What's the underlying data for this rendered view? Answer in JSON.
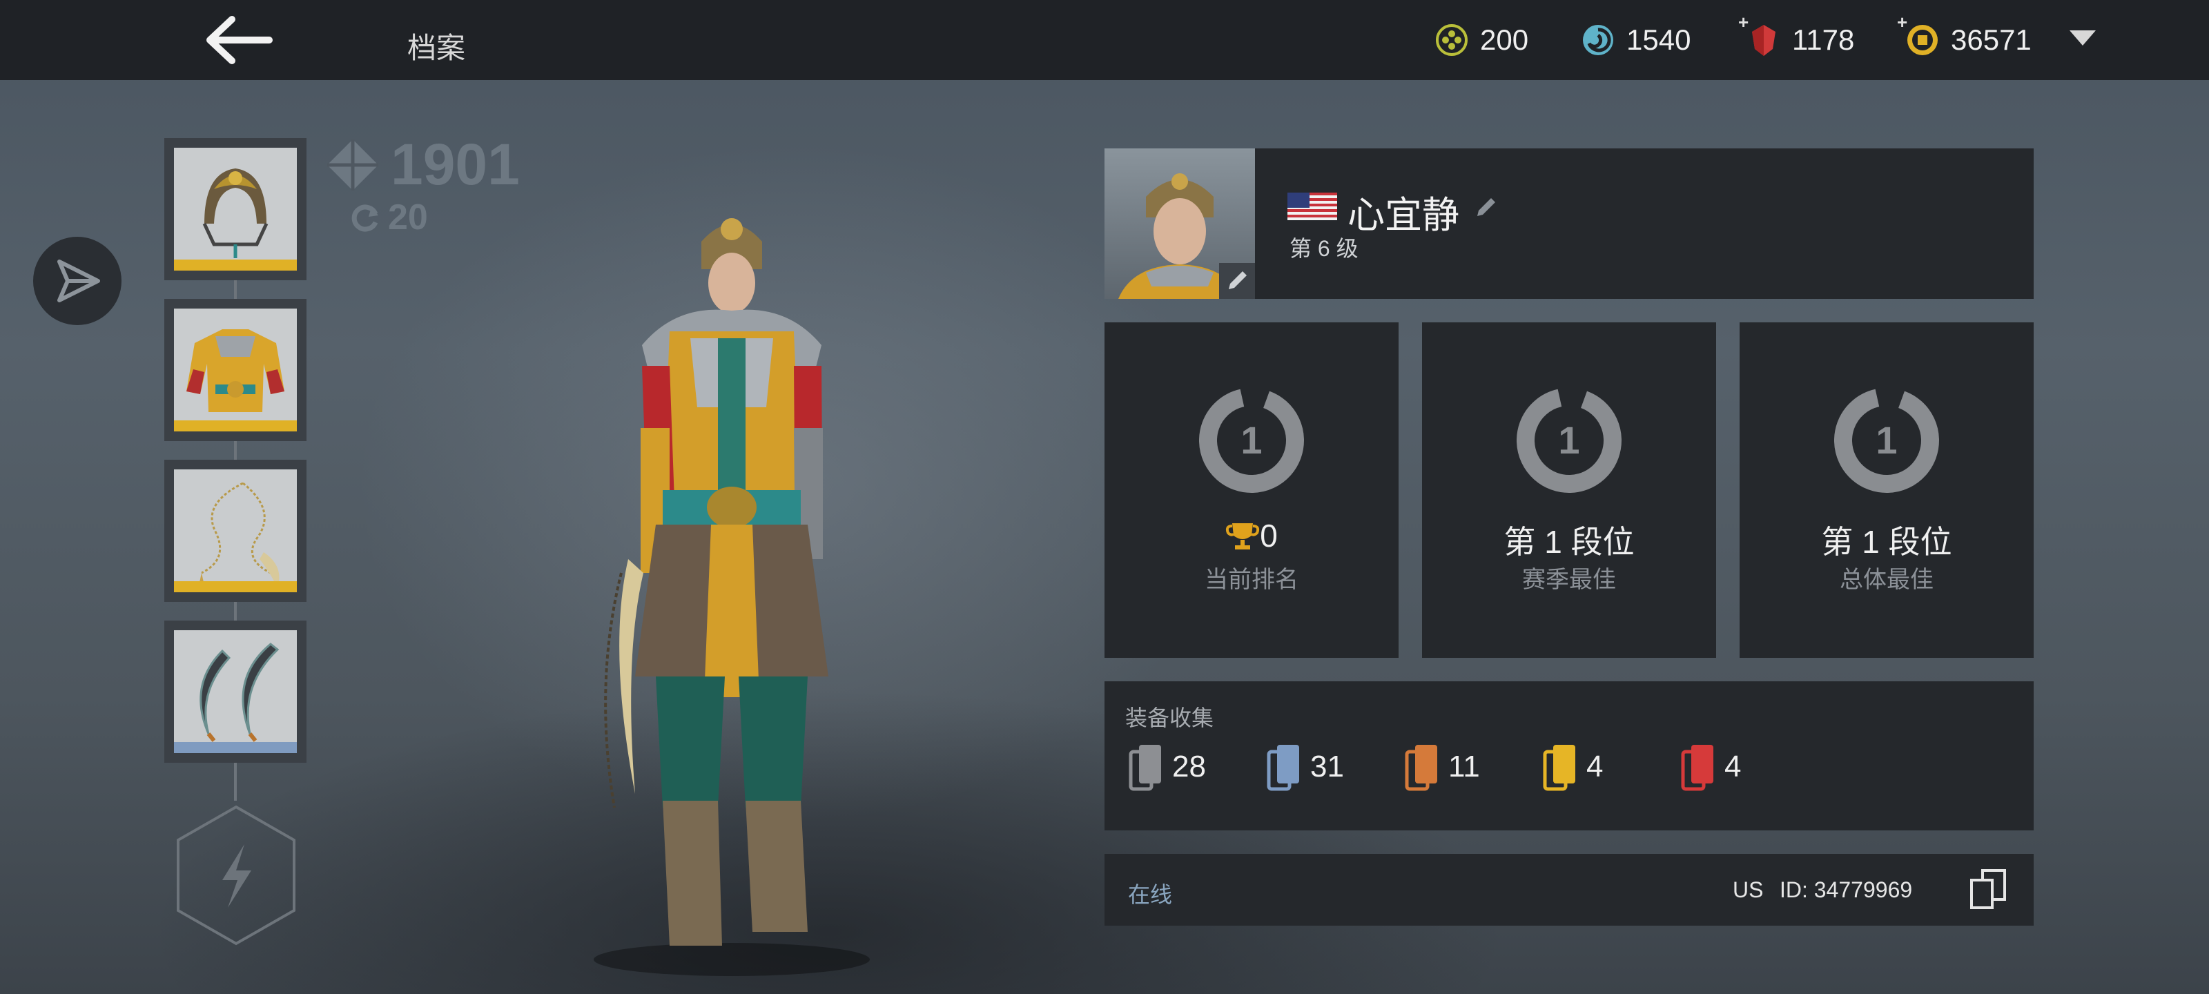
{
  "header": {
    "title": "档案",
    "currencies": [
      {
        "name": "tokens",
        "value": "200",
        "color": "#b9bf3a"
      },
      {
        "name": "energy",
        "value": "1540",
        "color": "#5fb3c9"
      },
      {
        "name": "rubies",
        "value": "1178",
        "color": "#d03a3a"
      },
      {
        "name": "coins",
        "value": "36571",
        "color": "#e0b126"
      }
    ]
  },
  "character": {
    "power": "1901",
    "refresh": "20",
    "equipment": [
      {
        "slot": "helmet",
        "rarity_color": "#e0b126"
      },
      {
        "slot": "armor",
        "rarity_color": "#e0b126"
      },
      {
        "slot": "weapon",
        "rarity_color": "#e0b126"
      },
      {
        "slot": "ranged",
        "rarity_color": "#7f9bc0"
      }
    ]
  },
  "profile": {
    "name": "心宜静",
    "level": "第 6 级",
    "flag": "us-flag"
  },
  "ranks": [
    {
      "ring_number": "1",
      "main": "0",
      "label": "当前排名",
      "has_trophy": true
    },
    {
      "ring_number": "1",
      "main": "第 1 段位",
      "label": "赛季最佳",
      "has_trophy": false
    },
    {
      "ring_number": "1",
      "main": "第 1 段位",
      "label": "总体最佳",
      "has_trophy": false
    }
  ],
  "collection": {
    "title": "装备收集",
    "items": [
      {
        "rarity": "common",
        "count": "28",
        "color": "#8d8f93"
      },
      {
        "rarity": "uncommon",
        "count": "31",
        "color": "#7e9cc4"
      },
      {
        "rarity": "rare",
        "count": "11",
        "color": "#d57a3a"
      },
      {
        "rarity": "epic",
        "count": "4",
        "color": "#e6b526"
      },
      {
        "rarity": "legendary",
        "count": "4",
        "color": "#d63a3a"
      }
    ]
  },
  "status": {
    "online": "在线",
    "region": "US",
    "player_id": "ID: 34779969"
  }
}
